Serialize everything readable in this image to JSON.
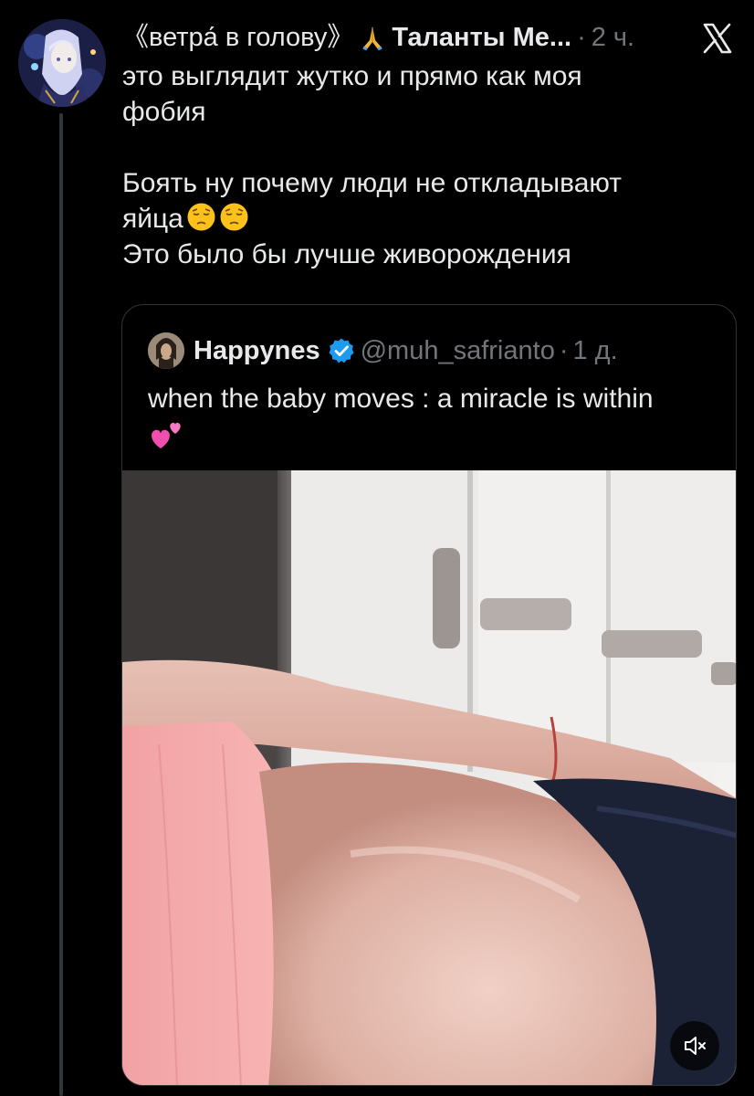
{
  "tweet": {
    "author_display_name": "《ветра́ в голову》",
    "author_handle_truncated": "Таланты Ме...",
    "separator": "·",
    "time": "2 ч.",
    "lines": [
      "это выглядит жутко и прямо как моя",
      "фобия",
      "",
      "Боять ну почему люди не откладывают",
      "яйца",
      "Это было бы лучше живорождения"
    ],
    "emoji_after_line_5": [
      "pensive-face",
      "pensive-face"
    ]
  },
  "quote": {
    "name": "Happynes",
    "verified": true,
    "handle": "@muh_safrianto",
    "separator": "·",
    "time": "1 д.",
    "text": "when the baby moves : a miracle is within",
    "emoji": "two-hearts",
    "media_kind": "video",
    "media_muted": true
  },
  "colors": {
    "background": "#000000",
    "text": "#e7e9ea",
    "secondary": "#71767b",
    "border": "#2f3336",
    "verified": "#1d9bf0"
  }
}
